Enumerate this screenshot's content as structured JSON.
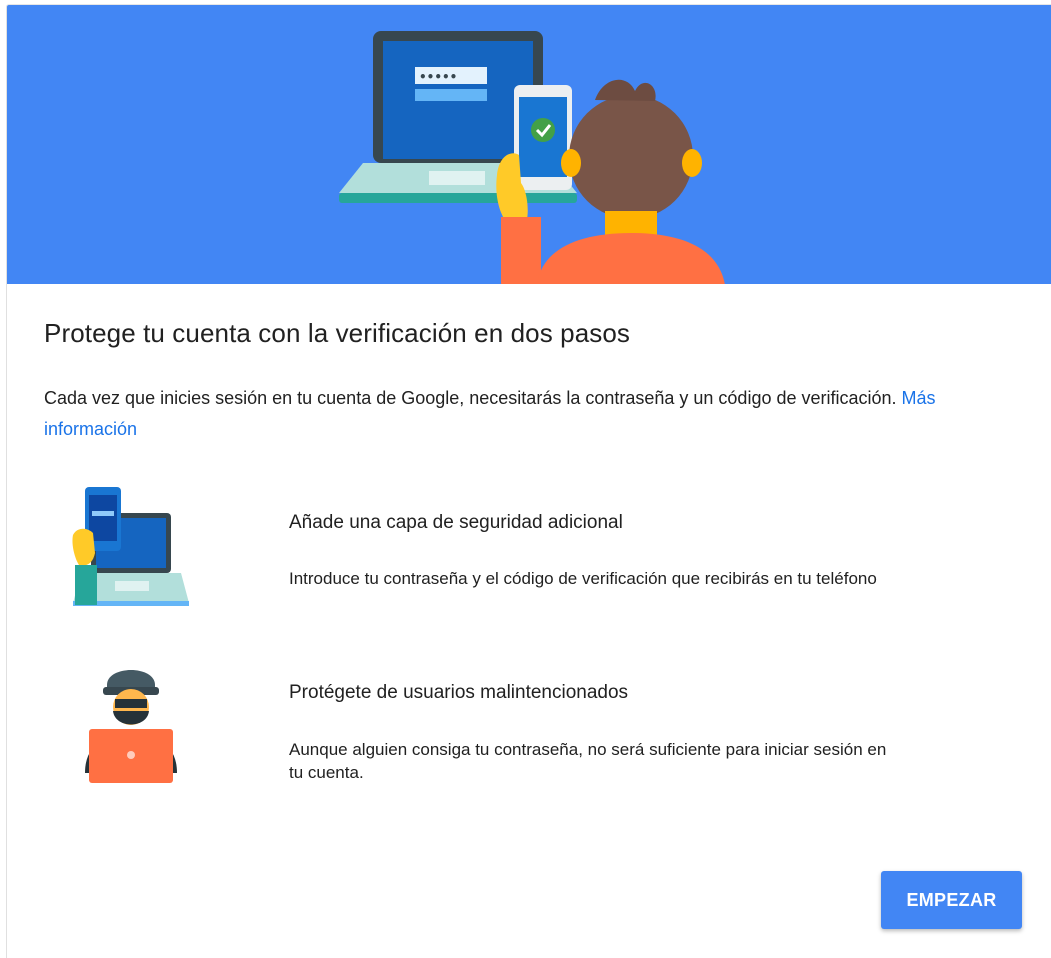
{
  "card": {
    "title": "Protege tu cuenta con la verificación en dos pasos",
    "description": "Cada vez que inicies sesión en tu cuenta de Google, necesitarás la contraseña y un código de verificación.",
    "learn_more_link": "Más información"
  },
  "hero": {
    "password_mask": "•••••",
    "background_color": "#4286f4"
  },
  "features": [
    {
      "title": "Añade una capa de seguridad adicional",
      "text": "Introduce tu contraseña y el código de verificación que recibirás en tu teléfono",
      "icon": "phone-and-laptop-illustration"
    },
    {
      "title": "Protégete de usuarios malintencionados",
      "text": "Aunque alguien consiga tu contraseña, no será suficiente para iniciar sesión en tu cuenta.",
      "icon": "hacker-illustration"
    }
  ],
  "actions": {
    "start_label": "EMPEZAR"
  },
  "colors": {
    "accent": "#4286f4",
    "link": "#1a73e8",
    "text": "#212121"
  }
}
